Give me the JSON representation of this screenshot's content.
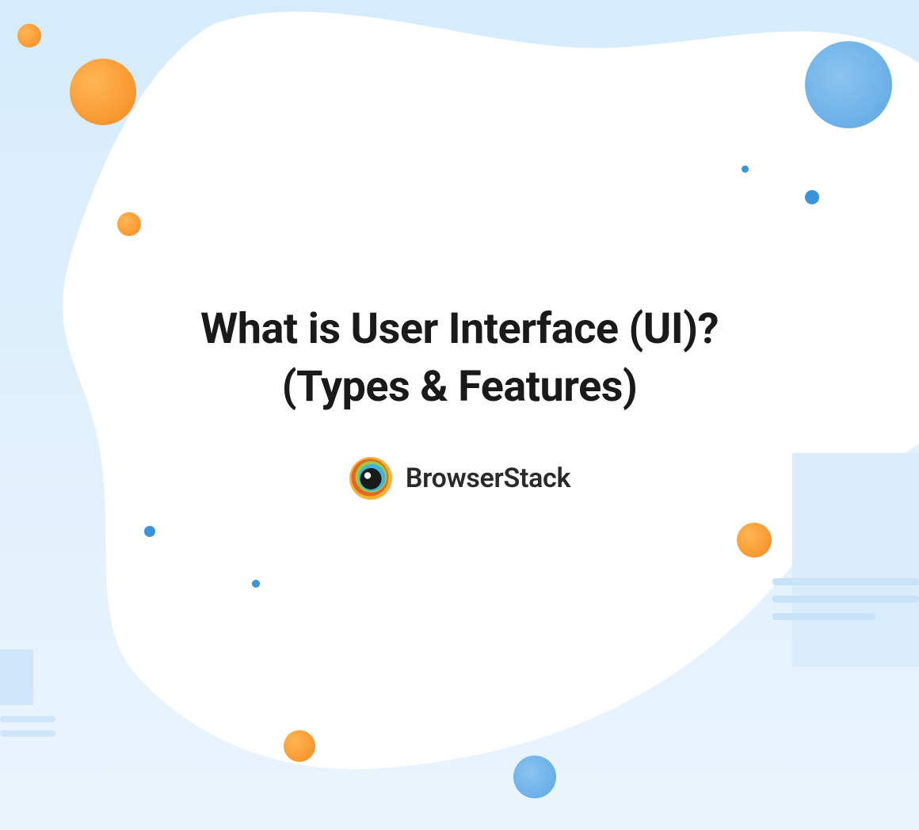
{
  "title": "What is User Interface (UI)? (Types & Features)",
  "brand": "BrowserStack",
  "colors": {
    "orange": "#f58a1f",
    "blue": "#5ba8e5",
    "lightBlue": "#d6ecfc",
    "text": "#1a1a1a"
  }
}
